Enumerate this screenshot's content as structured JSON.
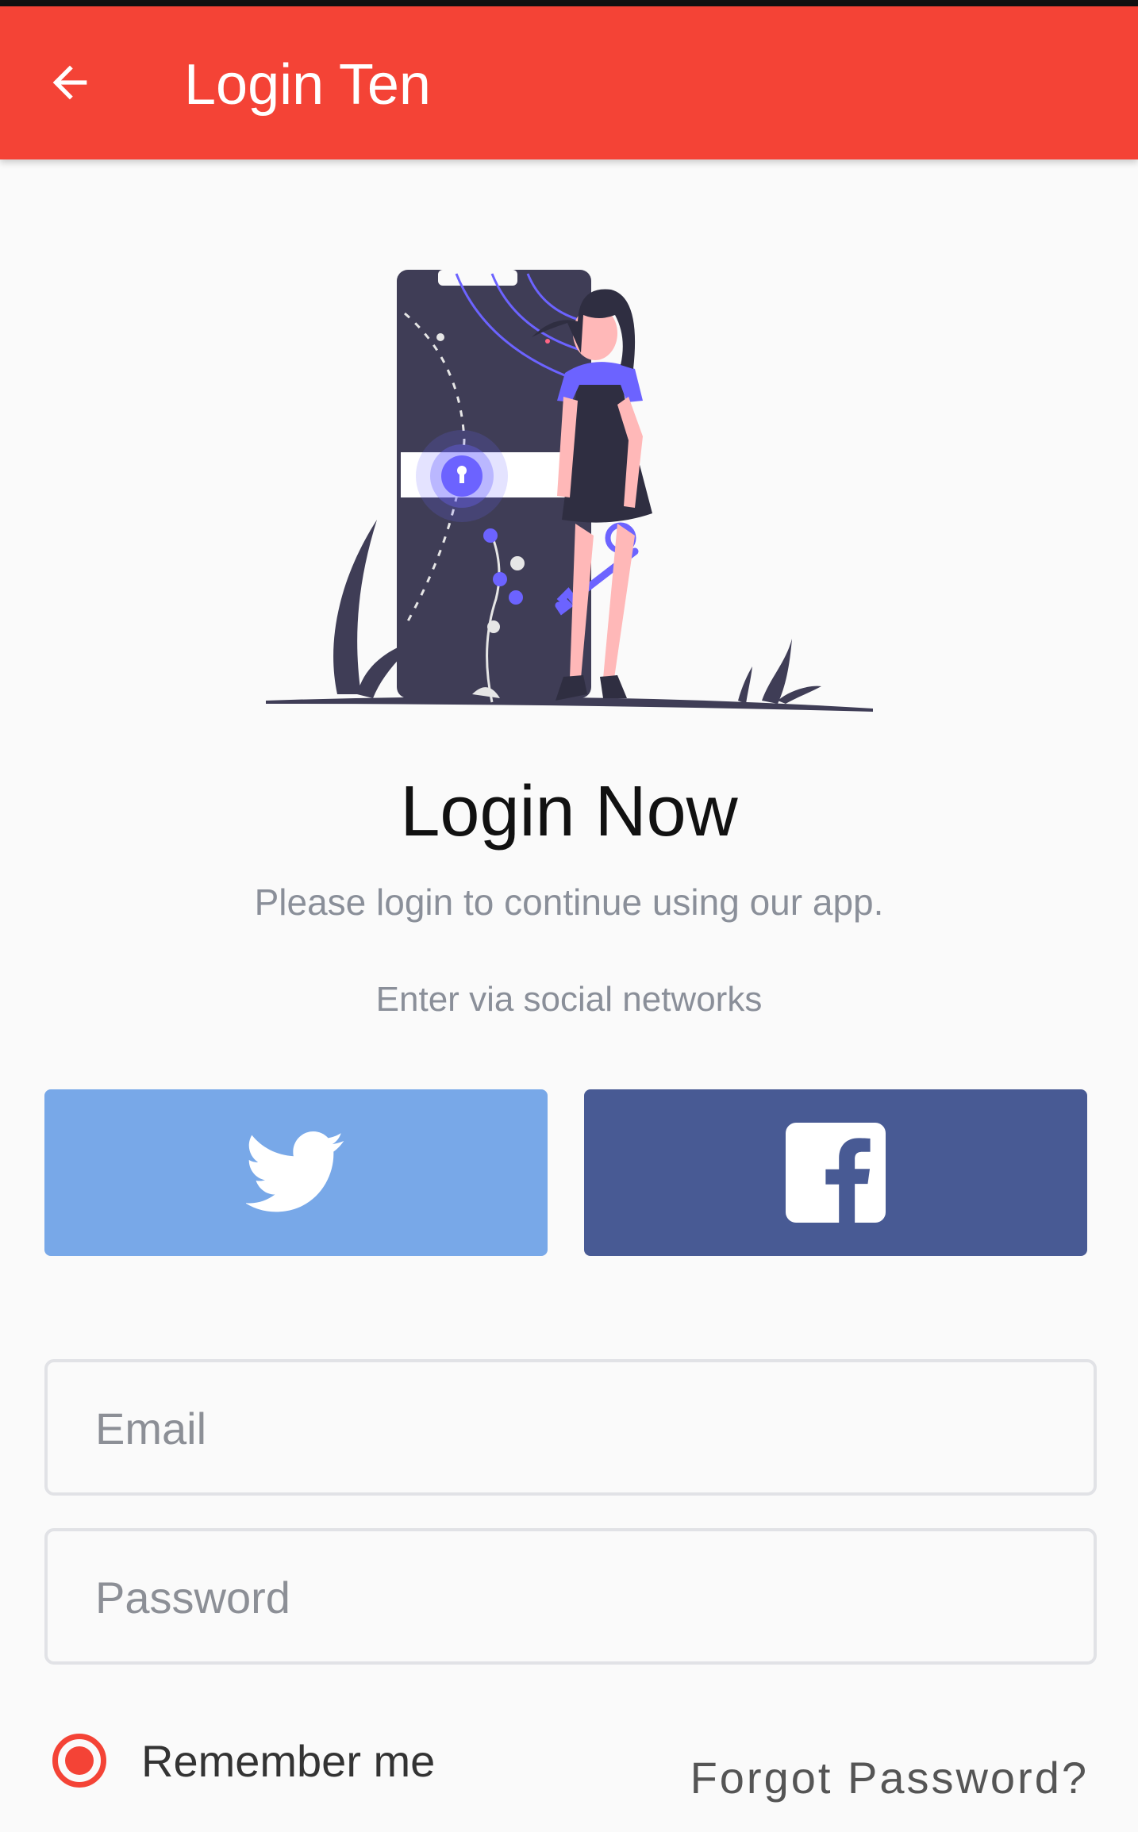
{
  "appbar": {
    "title": "Login Ten",
    "back_icon": "arrow-left-icon",
    "color": "#f44336"
  },
  "hero": {
    "illustration": "login-illustration"
  },
  "main": {
    "heading": "Login Now",
    "subheading": "Please login to continue using our app.",
    "social_caption": "Enter via social networks"
  },
  "social": {
    "twitter": {
      "icon": "twitter-icon",
      "color": "#78a8e8"
    },
    "facebook": {
      "icon": "facebook-icon",
      "color": "#485a94"
    }
  },
  "form": {
    "email_placeholder": "Email",
    "email_value": "",
    "password_placeholder": "Password",
    "password_value": "",
    "remember_label": "Remember me",
    "remember_checked": true,
    "forgot_label": "Forgot Password?"
  }
}
